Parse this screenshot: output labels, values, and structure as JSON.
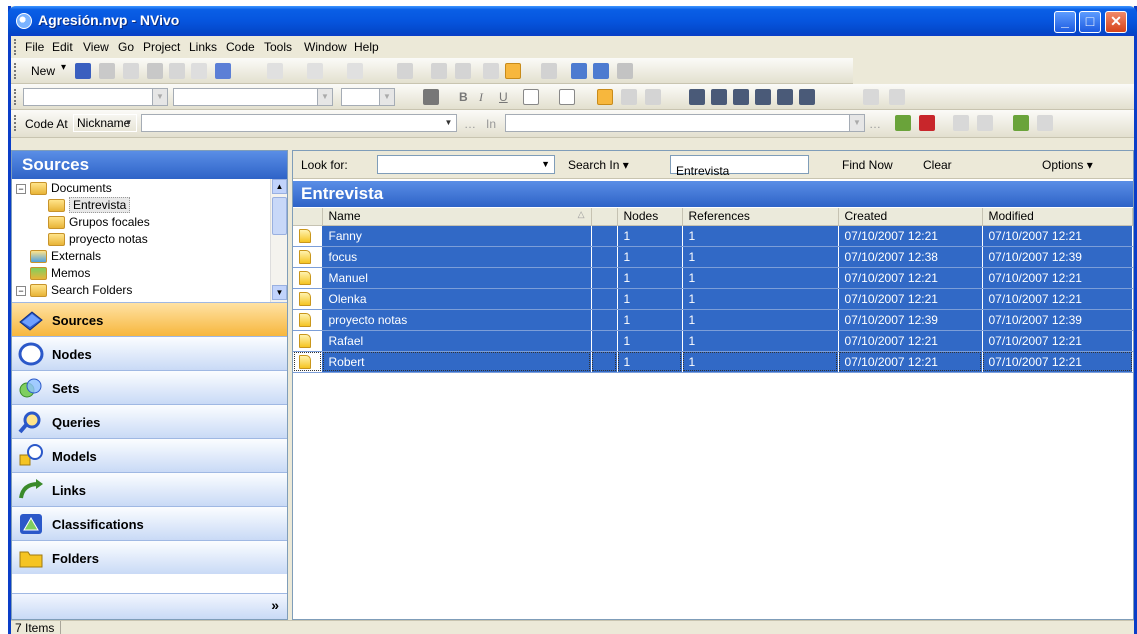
{
  "window": {
    "title": "Agresión.nvp - NVivo",
    "min": "_",
    "max": "□",
    "close": "✕"
  },
  "menu": [
    "File",
    "Edit",
    "View",
    "Go",
    "Project",
    "Links",
    "Code",
    "Tools",
    "Window",
    "Help"
  ],
  "toolbar1": {
    "new_label": "New"
  },
  "codebar": {
    "code_at_label": "Code At",
    "nickname_value": "Nickname",
    "in_label": "In"
  },
  "sources_panel": {
    "header": "Sources",
    "tree": [
      {
        "label": "Documents",
        "level": 0,
        "expanded": true
      },
      {
        "label": "Entrevista",
        "level": 1,
        "selected": true
      },
      {
        "label": "Grupos focales",
        "level": 1
      },
      {
        "label": "proyecto notas",
        "level": 1
      },
      {
        "label": "Externals",
        "level": 0
      },
      {
        "label": "Memos",
        "level": 0
      },
      {
        "label": "Search Folders",
        "level": 0,
        "expanded": true
      }
    ],
    "nav": [
      "Sources",
      "Nodes",
      "Sets",
      "Queries",
      "Models",
      "Links",
      "Classifications",
      "Folders"
    ],
    "nav_active": "Sources",
    "footer_glyph": "»"
  },
  "findbar": {
    "look_for_label": "Look for:",
    "look_for_value": "",
    "search_in_label": "Search In ▾",
    "search_in_value": "Entrevista",
    "find_now": "Find Now",
    "clear": "Clear",
    "options": "Options ▾"
  },
  "list": {
    "title": "Entrevista",
    "columns": [
      "Name",
      "Nodes",
      "References",
      "Created",
      "Modified"
    ],
    "rows": [
      {
        "name": "Fanny",
        "nodes": "1",
        "refs": "1",
        "created": "07/10/2007 12:21",
        "modified": "07/10/2007 12:21"
      },
      {
        "name": "focus",
        "nodes": "1",
        "refs": "1",
        "created": "07/10/2007 12:38",
        "modified": "07/10/2007 12:39"
      },
      {
        "name": "Manuel",
        "nodes": "1",
        "refs": "1",
        "created": "07/10/2007 12:21",
        "modified": "07/10/2007 12:21"
      },
      {
        "name": "Olenka",
        "nodes": "1",
        "refs": "1",
        "created": "07/10/2007 12:21",
        "modified": "07/10/2007 12:21"
      },
      {
        "name": "proyecto notas",
        "nodes": "1",
        "refs": "1",
        "created": "07/10/2007 12:39",
        "modified": "07/10/2007 12:39"
      },
      {
        "name": "Rafael",
        "nodes": "1",
        "refs": "1",
        "created": "07/10/2007 12:21",
        "modified": "07/10/2007 12:21"
      },
      {
        "name": "Robert",
        "nodes": "1",
        "refs": "1",
        "created": "07/10/2007 12:21",
        "modified": "07/10/2007 12:21"
      }
    ]
  },
  "status": {
    "items": "7 Items"
  }
}
